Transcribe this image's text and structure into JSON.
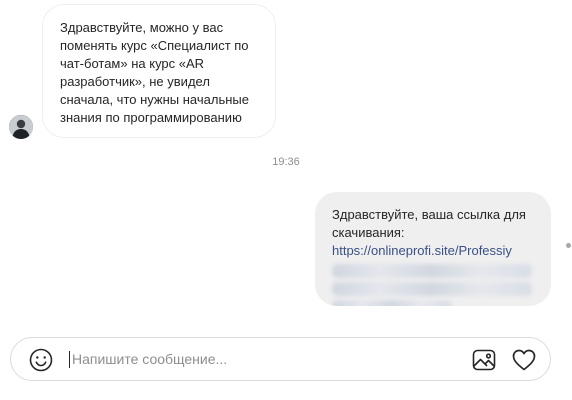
{
  "conversation": {
    "incoming": {
      "lines": [
        "Здравствуйте, можно у вас",
        "поменять курс «Специалист по",
        "чат-ботам» на курс «AR",
        "разработчик», не увидел",
        "сначала, что нужны начальные",
        "знания по программированию"
      ]
    },
    "timestamp": "19:36",
    "outgoing": {
      "lines": [
        "Здравствуйте, ваша ссылка для",
        "скачивания:"
      ],
      "link": "https://onlineprofi.site/Professiy"
    }
  },
  "composer": {
    "placeholder": "Напишите сообщение..."
  },
  "icons": {
    "emoji": "smiley-face-icon",
    "image": "image-icon",
    "like": "heart-icon"
  }
}
